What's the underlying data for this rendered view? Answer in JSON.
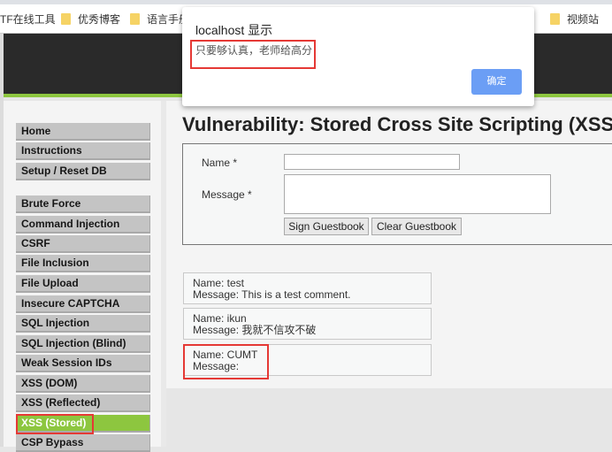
{
  "bookmarks": [
    {
      "label": "TF在线工具",
      "folder": false
    },
    {
      "label": "优秀博客",
      "folder": true
    },
    {
      "label": "语言手册",
      "folder": true
    },
    {
      "label": "视频站",
      "folder": true
    }
  ],
  "dialog": {
    "title": "localhost 显示",
    "message": "只要够认真，老师给高分",
    "ok_label": "确定"
  },
  "sidebar": {
    "items": [
      {
        "label": "Home"
      },
      {
        "label": "Instructions"
      },
      {
        "label": "Setup / Reset DB"
      },
      {
        "label": "Brute Force"
      },
      {
        "label": "Command Injection"
      },
      {
        "label": "CSRF"
      },
      {
        "label": "File Inclusion"
      },
      {
        "label": "File Upload"
      },
      {
        "label": "Insecure CAPTCHA"
      },
      {
        "label": "SQL Injection"
      },
      {
        "label": "SQL Injection (Blind)"
      },
      {
        "label": "Weak Session IDs"
      },
      {
        "label": "XSS (DOM)"
      },
      {
        "label": "XSS (Reflected)"
      },
      {
        "label": "XSS (Stored)",
        "active": true
      },
      {
        "label": "CSP Bypass"
      }
    ]
  },
  "main": {
    "title": "Vulnerability: Stored Cross Site Scripting (XSS)",
    "form": {
      "name_label": "Name *",
      "name_value": "",
      "message_label": "Message *",
      "message_value": "",
      "sign_label": "Sign Guestbook",
      "clear_label": "Clear Guestbook"
    },
    "entries": [
      {
        "name": "Name: test",
        "message": "Message: This is a test comment."
      },
      {
        "name": "Name: ikun",
        "message": "Message: 我就不信攻不破"
      },
      {
        "name": "Name: CUMT",
        "message": "Message:"
      }
    ]
  },
  "colors": {
    "accent_green": "#8dc63f",
    "header_dark": "#2a2a2a",
    "highlight_red": "#e53935",
    "dialog_button": "#6b9ef5"
  }
}
